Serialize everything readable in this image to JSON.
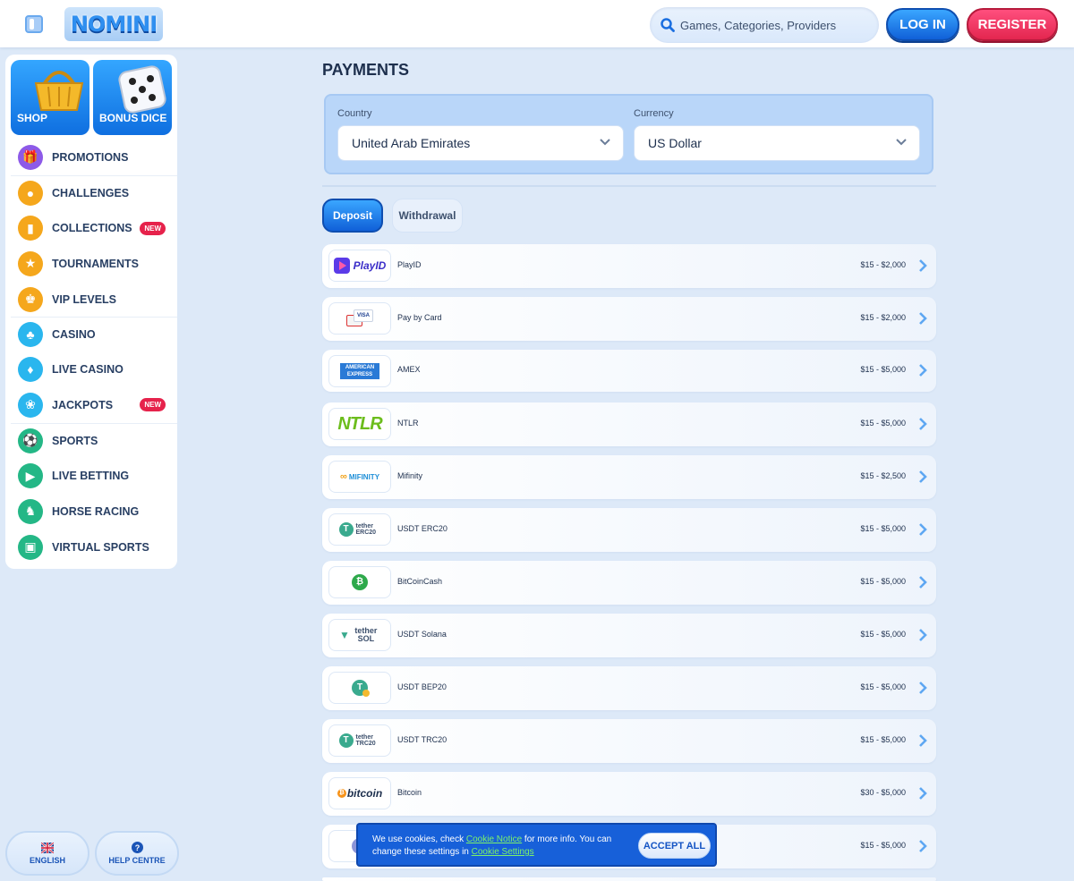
{
  "header": {
    "logo_text": "NOMINI",
    "search_placeholder": "Games, Categories, Providers",
    "login_label": "LOG IN",
    "register_label": "REGISTER"
  },
  "sidebar": {
    "tiles": [
      {
        "label": "SHOP",
        "icon": "basket-icon"
      },
      {
        "label": "BONUS DICE",
        "icon": "dice-icon"
      }
    ],
    "groups": [
      [
        {
          "label": "PROMOTIONS",
          "icon": "gift-icon",
          "color": "#8d5ae8"
        }
      ],
      [
        {
          "label": "CHALLENGES",
          "icon": "medal-icon",
          "color": "#f5a71c"
        },
        {
          "label": "COLLECTIONS",
          "icon": "cards-icon",
          "color": "#f5a71c",
          "badge": "NEW"
        },
        {
          "label": "TOURNAMENTS",
          "icon": "trophy-icon",
          "color": "#f5a71c"
        },
        {
          "label": "VIP LEVELS",
          "icon": "crown-icon",
          "color": "#f5a71c"
        }
      ],
      [
        {
          "label": "CASINO",
          "icon": "cherry-icon",
          "color": "#2ab6ee"
        },
        {
          "label": "LIVE CASINO",
          "icon": "card-icon",
          "color": "#2ab6ee"
        },
        {
          "label": "JACKPOTS",
          "icon": "clover-icon",
          "color": "#2ab6ee",
          "badge": "NEW"
        }
      ],
      [
        {
          "label": "SPORTS",
          "icon": "ball-icon",
          "color": "#24b786"
        },
        {
          "label": "LIVE BETTING",
          "icon": "play-screen-icon",
          "color": "#24b786"
        },
        {
          "label": "HORSE RACING",
          "icon": "horse-icon",
          "color": "#24b786"
        },
        {
          "label": "VIRTUAL SPORTS",
          "icon": "monitor-icon",
          "color": "#24b786"
        }
      ]
    ],
    "bottom": {
      "language_label": "ENGLISH",
      "help_label": "HELP CENTRE"
    }
  },
  "main": {
    "title": "PAYMENTS",
    "country_label": "Country",
    "country_value": "United Arab Emirates",
    "currency_label": "Currency",
    "currency_value": "US Dollar",
    "tabs": [
      "Deposit",
      "Withdrawal"
    ],
    "methods": [
      {
        "logo": "PlayID",
        "name": "PlayID",
        "range": "$15 - $2,000"
      },
      {
        "logo": "VISA",
        "name": "Pay by Card",
        "range": "$15 - $2,000"
      },
      {
        "logo": "AMERICAN EXPRESS",
        "name": "AMEX",
        "range": "$15 - $5,000"
      },
      {
        "logo": "NTLR",
        "name": "NTLR",
        "range": "$15 - $5,000"
      },
      {
        "logo": "MIFINITY",
        "name": "Mifinity",
        "range": "$15 - $2,500"
      },
      {
        "logo": "tether ERC20",
        "name": "USDT ERC20",
        "range": "$15 - $5,000"
      },
      {
        "logo": "",
        "name": "BitCoinCash",
        "range": "$15 - $5,000"
      },
      {
        "logo": "tether SOL",
        "name": "USDT Solana",
        "range": "$15 - $5,000"
      },
      {
        "logo": "",
        "name": "USDT BEP20",
        "range": "$15 - $5,000"
      },
      {
        "logo": "tether TRC20",
        "name": "USDT TRC20",
        "range": "$15 - $5,000"
      },
      {
        "logo": "bitcoin",
        "name": "Bitcoin",
        "range": "$30 - $5,000"
      },
      {
        "logo": "",
        "name": "",
        "range": "$15 - $5,000"
      }
    ]
  },
  "cookie": {
    "text_1": "We use cookies, check ",
    "link_1": "Cookie Notice",
    "text_2": " for more info. You can change these settings in ",
    "link_2": "Cookie Settings",
    "accept_label": "ACCEPT ALL"
  },
  "colors": {
    "primary_blue": "#1760d9",
    "register_red": "#e3264f",
    "page_bg": "#dde9f8"
  }
}
